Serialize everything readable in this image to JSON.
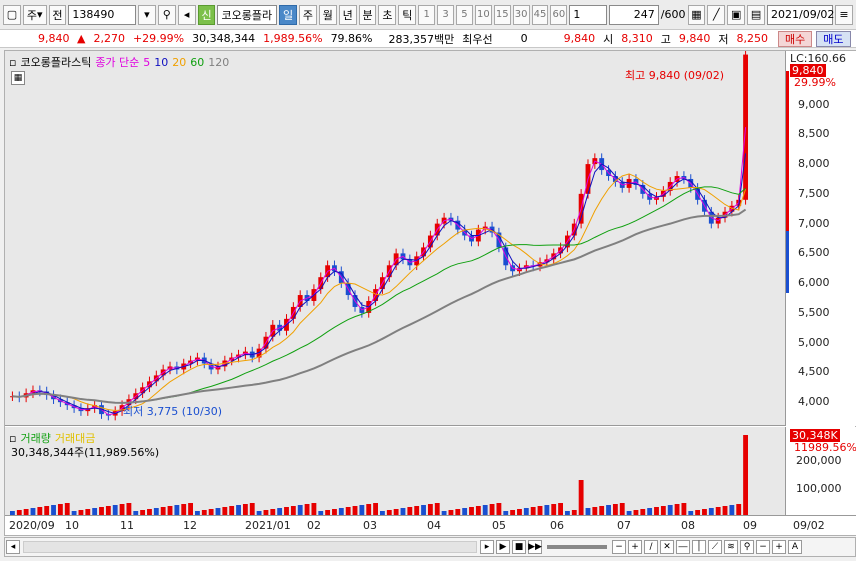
{
  "toolbar": {
    "type_label": "주",
    "market_label": "전",
    "code": "138490",
    "credit_badge": "신",
    "stock_name": "코오롱플라",
    "period_tabs": [
      "일",
      "주",
      "월",
      "년",
      "분",
      "초",
      "틱"
    ],
    "interval_buttons": [
      "1",
      "3",
      "5",
      "10",
      "15",
      "30",
      "45",
      "60"
    ],
    "interval_value": "1",
    "count": "247",
    "count_total": "/600",
    "date": "2021/09/02"
  },
  "quote": {
    "price": "9,840",
    "change": "2,270",
    "change_pct": "+29.99%",
    "volume": "30,348,344",
    "volume_pct": "1,989.56%",
    "rate": "79.86%",
    "amount": "283,357백만",
    "pref_label": "최우선",
    "pref_value": "0",
    "last": "9,840",
    "open_label": "시",
    "open": "8,310",
    "high_label": "고",
    "high": "9,840",
    "low_label": "저",
    "low": "8,250",
    "buy_label": "매수",
    "sell_label": "매도"
  },
  "price_pane": {
    "title": "코오롱플라스틱",
    "ma_label": "종가 단순",
    "ma_periods": [
      "5",
      "10",
      "20",
      "60",
      "120"
    ],
    "ma_colors": [
      "#e000e0",
      "#1010c0",
      "#f0a000",
      "#10a010",
      "#808080"
    ],
    "high_annotation": "최고 9,840 (09/02)",
    "low_annotation": "최저 3,775 (10/30)",
    "last_price_badge": "9,840",
    "last_pct_label": "29.99%",
    "lc_label": "LC:160.66",
    "y_ticks": [
      "9,000",
      "8,500",
      "8,000",
      "7,500",
      "7,000",
      "6,500",
      "6,000",
      "5,500",
      "5,000",
      "4,500",
      "4,000"
    ]
  },
  "vol_pane": {
    "title": "거래량",
    "title2": "거래대금",
    "value_label": "30,348,344주(11,989.56%)",
    "badge": "30,348K",
    "badge_pct": "11989.56%",
    "y_ticks": [
      "200,000",
      "100,000"
    ]
  },
  "x_axis": {
    "labels": [
      "2020/09",
      "10",
      "11",
      "12",
      "2021/01",
      "02",
      "03",
      "04",
      "05",
      "06",
      "07",
      "08",
      "09",
      "09/02"
    ]
  },
  "colors": {
    "up": "#e60000",
    "down": "#1a4fd0",
    "accent": "#4a88c8"
  },
  "chart_data": {
    "type": "candlestick",
    "x_range": [
      "2020/09",
      "2021/09/02"
    ],
    "ylim": [
      3600,
      9900
    ],
    "closes": [
      4100,
      4080,
      4150,
      4200,
      4180,
      4120,
      4050,
      4000,
      3950,
      3900,
      3850,
      3900,
      3950,
      3800,
      3775,
      3850,
      3950,
      4050,
      4150,
      4250,
      4350,
      4450,
      4550,
      4600,
      4550,
      4650,
      4700,
      4750,
      4650,
      4550,
      4600,
      4700,
      4750,
      4800,
      4850,
      4750,
      4900,
      5100,
      5300,
      5200,
      5400,
      5600,
      5800,
      5700,
      5900,
      6100,
      6300,
      6200,
      6000,
      5800,
      5600,
      5500,
      5700,
      5900,
      6100,
      6300,
      6500,
      6400,
      6300,
      6450,
      6600,
      6800,
      7000,
      7100,
      7050,
      6900,
      6800,
      6700,
      6900,
      6950,
      6850,
      6600,
      6300,
      6200,
      6250,
      6300,
      6280,
      6350,
      6400,
      6500,
      6600,
      6800,
      7000,
      7500,
      8000,
      8100,
      7900,
      7800,
      7700,
      7600,
      7750,
      7650,
      7500,
      7400,
      7450,
      7550,
      7700,
      7800,
      7750,
      7600,
      7400,
      7200,
      7000,
      7100,
      7200,
      7300,
      7400,
      9840
    ]
  }
}
